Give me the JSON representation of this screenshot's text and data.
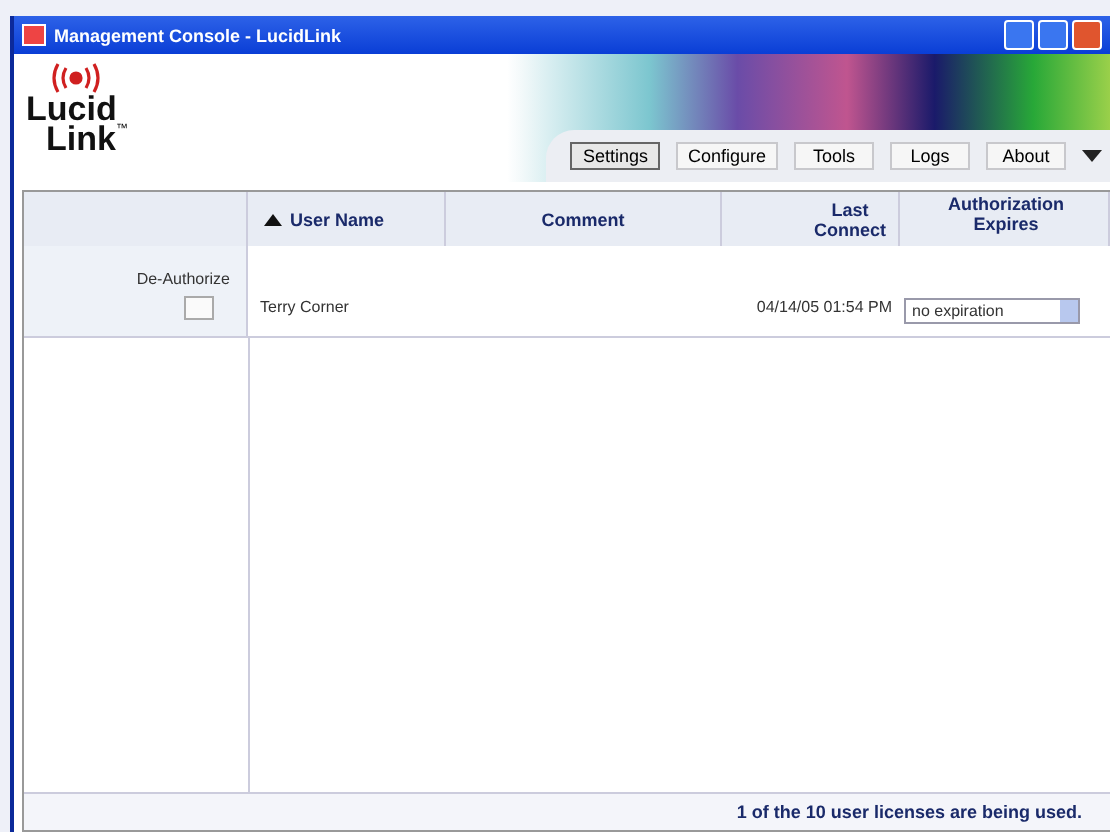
{
  "window": {
    "title": "Management Console - LucidLink"
  },
  "logo": {
    "line_1": "Lucid",
    "line_2": "Link",
    "trademark": "™"
  },
  "toolbar": [
    {
      "label": "Settings",
      "selected": true
    },
    {
      "label": "Configure",
      "selected": false
    },
    {
      "label": "Tools",
      "selected": false
    },
    {
      "label": "Logs",
      "selected": false
    },
    {
      "label": "About",
      "selected": false
    }
  ],
  "table": {
    "columns": [
      "",
      "User Name",
      "Comment",
      "Last Connect",
      "Authorization Expires"
    ],
    "rows": [
      {
        "action": "De-Authorize",
        "checked": false,
        "user_name": "Terry Corner",
        "last_connect": "04/14/05 01:54 PM",
        "expires": "no expiration"
      }
    ]
  },
  "status_bar": "1 of the 10 user licenses are being used."
}
